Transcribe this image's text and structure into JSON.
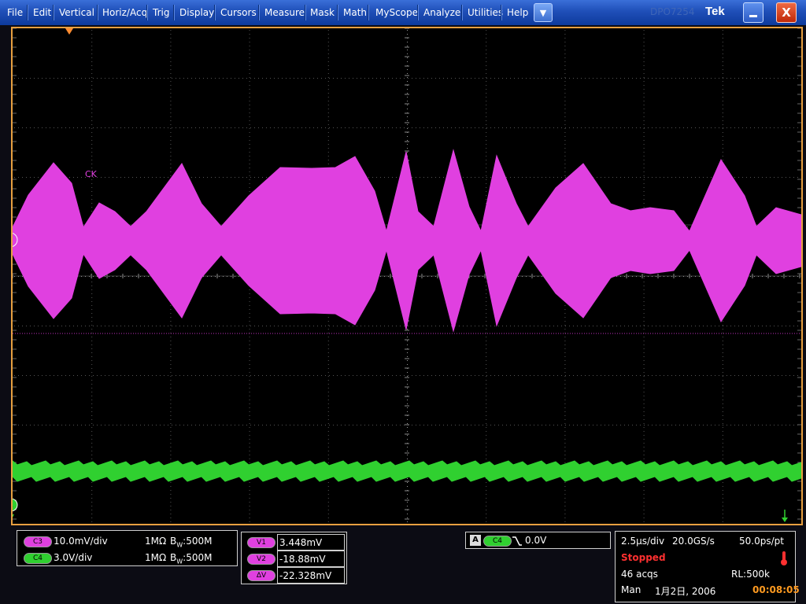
{
  "menu": {
    "items": [
      "File",
      "Edit",
      "Vertical",
      "Horiz/Acq",
      "Trig",
      "Display",
      "Cursors",
      "Measure",
      "Mask",
      "Math",
      "MyScope",
      "Analyze",
      "Utilities",
      "Help"
    ],
    "dropdown_icon": "triangle-down-icon"
  },
  "brand": "Tek",
  "ghost_label": "DPO7254",
  "window_buttons": {
    "minimize_icon": "minimize-icon",
    "close_label": "X"
  },
  "graticule": {
    "channel3_label": "CK",
    "channel3_marker": "3",
    "channel4_marker": "4"
  },
  "channels": {
    "c3": {
      "badge": "C3",
      "scale": "10.0mV/div",
      "impedance": "1MΩ",
      "bw_prefix": "B",
      "bw_sub": "W",
      "bw": ":500M",
      "color": "#e040e0"
    },
    "c4": {
      "badge": "C4",
      "scale": "3.0V/div",
      "impedance": "1MΩ",
      "bw_prefix": "B",
      "bw_sub": "W",
      "bw": ":500M",
      "color": "#30d030"
    }
  },
  "cursors": {
    "v1": {
      "label": "V1",
      "value": "3.448mV"
    },
    "v2": {
      "label": "V2",
      "value": "-18.88mV"
    },
    "dv": {
      "label": "ΔV",
      "value": "-22.328mV"
    }
  },
  "trigger": {
    "mode": "A",
    "source": "C4",
    "level": "0.0V"
  },
  "acquisition": {
    "timebase": "2.5µs/div",
    "sample_rate": "20.0GS/s",
    "resolution": "50.0ps/pt",
    "status": "Stopped",
    "acqs": "46 acqs",
    "record_length": "RL:500k",
    "mode": "Man",
    "date": "1月2日, 2006",
    "time": "00:08:05"
  }
}
